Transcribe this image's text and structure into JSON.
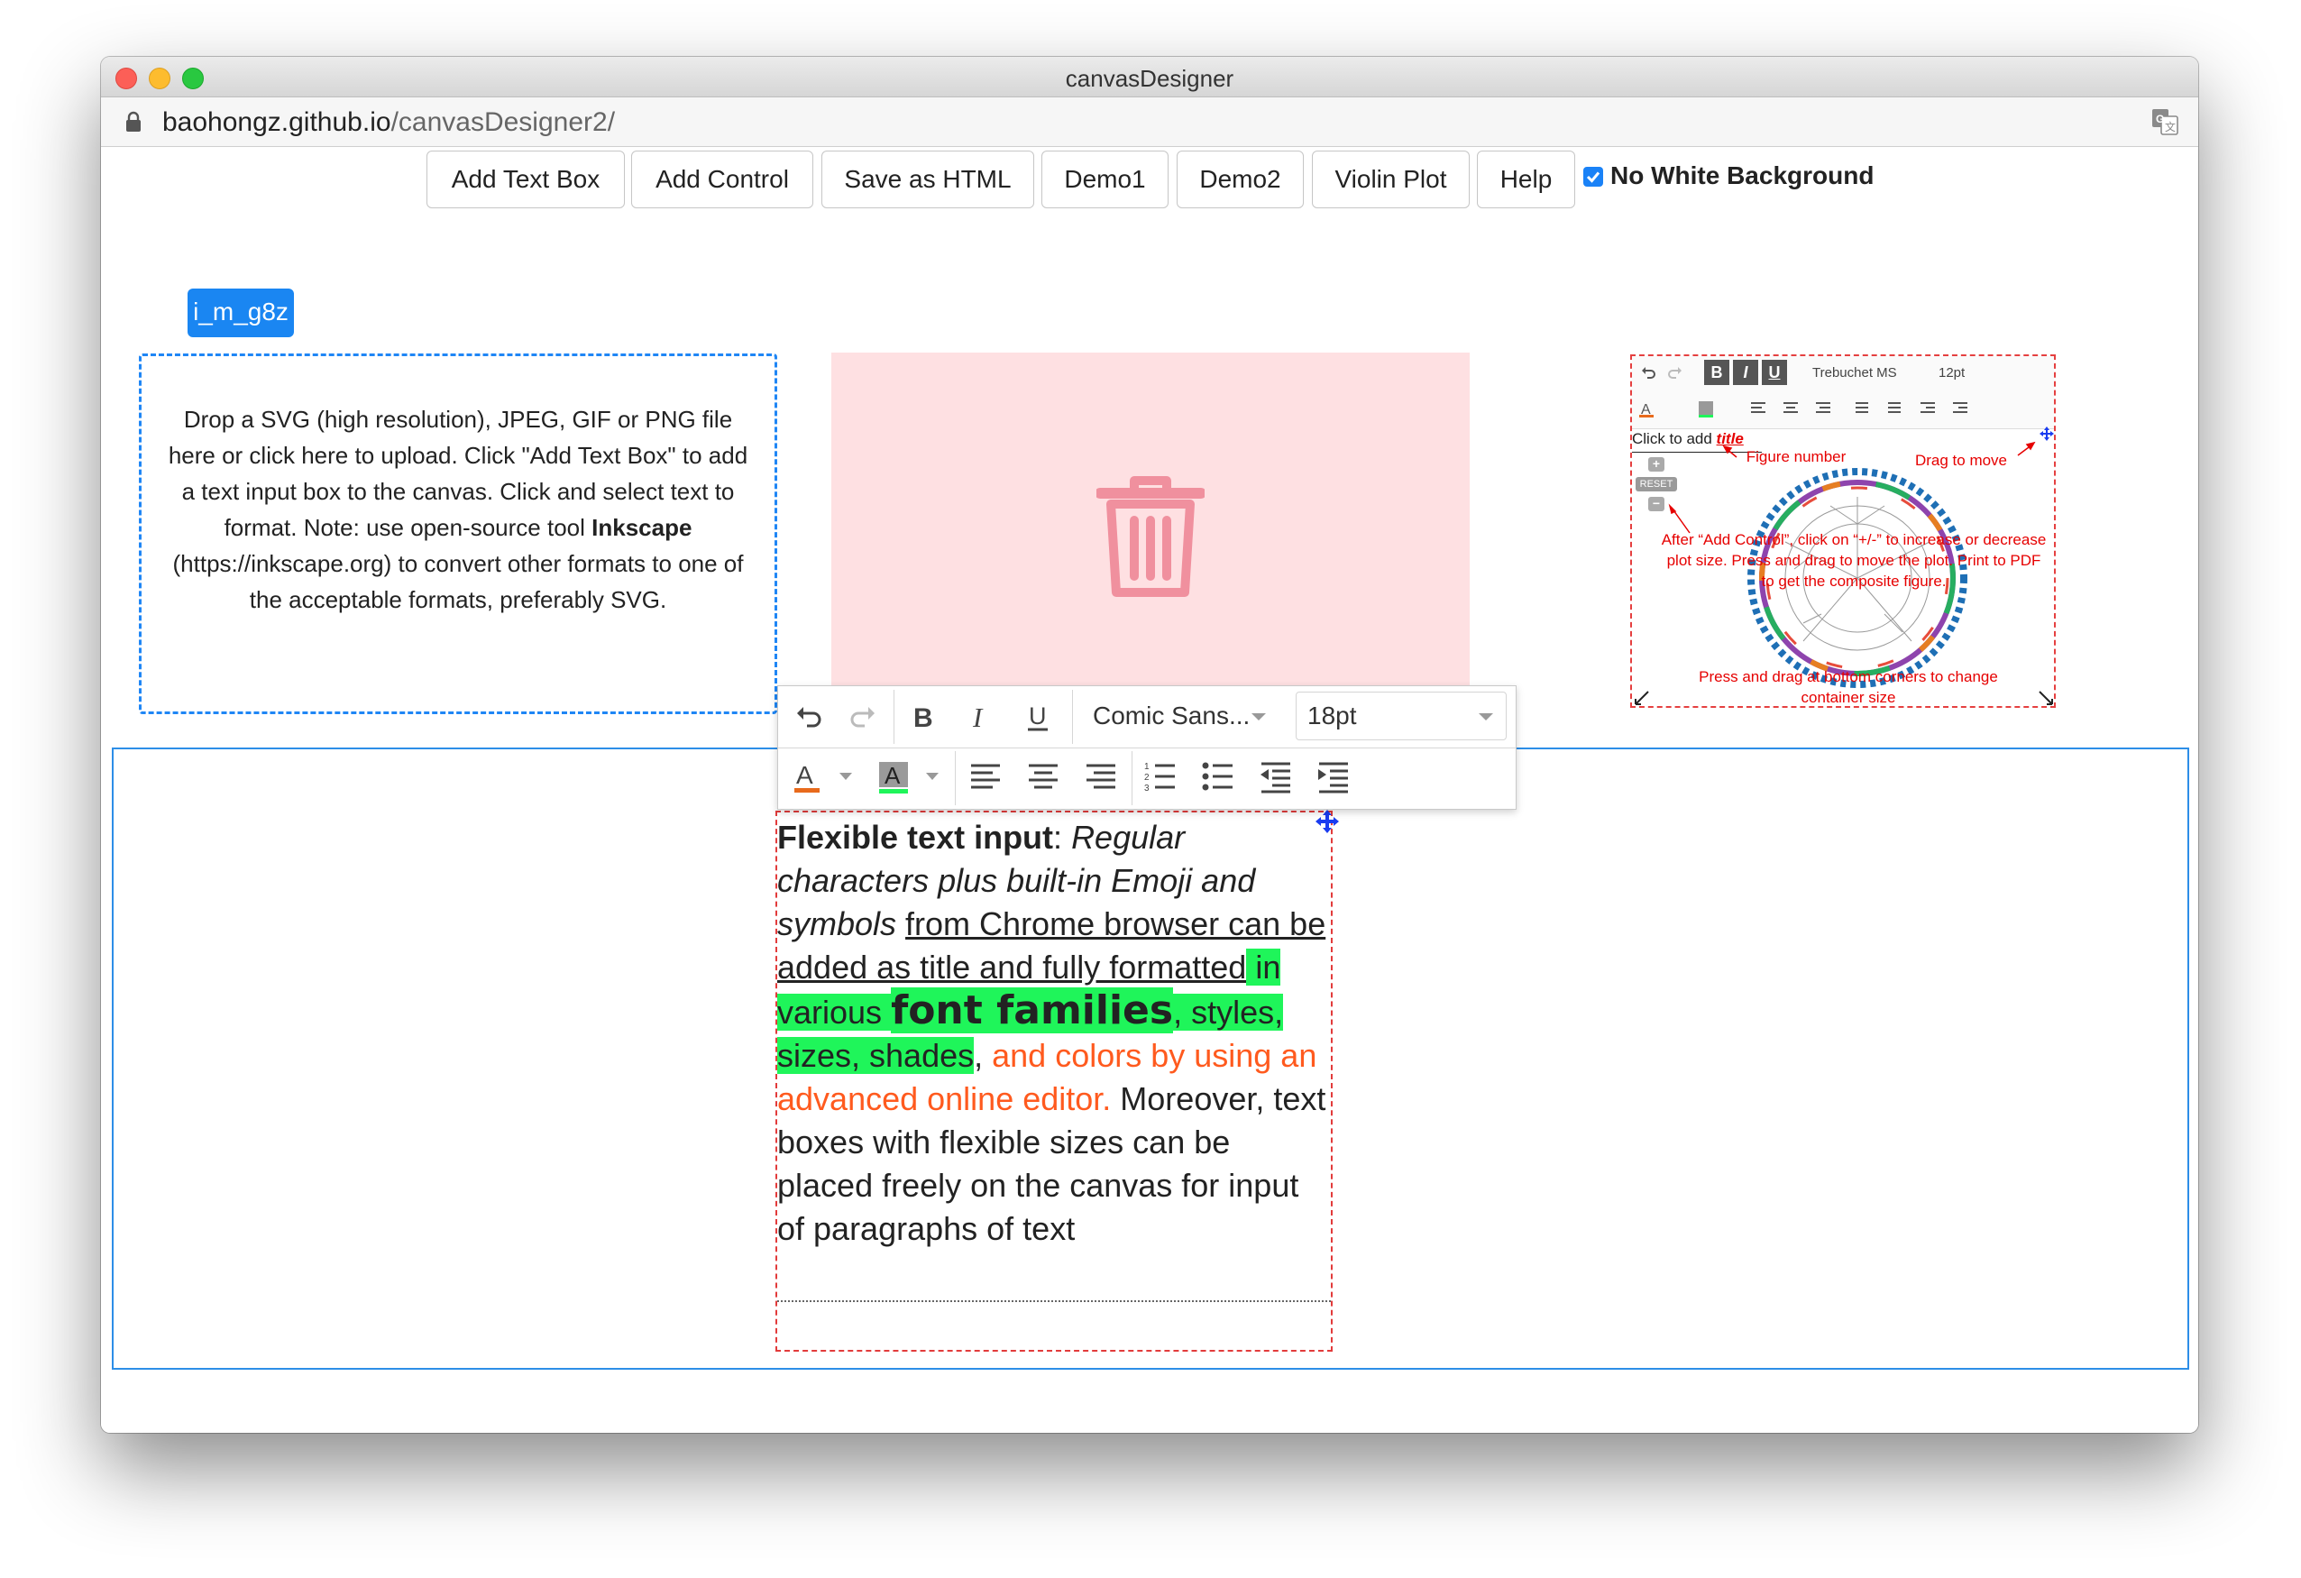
{
  "window": {
    "title": "canvasDesigner"
  },
  "address": {
    "host": "baohongz.github.io",
    "path": "/canvasDesigner2/"
  },
  "toolbar": {
    "buttons": [
      {
        "label": "Add Text Box"
      },
      {
        "label": "Add Control"
      },
      {
        "label": "Save as HTML"
      },
      {
        "label": "Demo1"
      },
      {
        "label": "Demo2"
      },
      {
        "label": "Violin Plot"
      },
      {
        "label": "Help"
      }
    ],
    "checkbox_label": "No White Background",
    "checkbox_checked": true
  },
  "element_tag": "i_m_g8z",
  "upload_box": {
    "text_part1": "Drop a SVG (high resolution), JPEG, GIF or PNG file here or click here to upload. Click \"Add Text Box\" to add a text input box to the canvas. Click and select text to format. Note: use open-source tool ",
    "text_bold": "Inkscape",
    "text_part2": " (https://inkscape.org) to convert other formats to one of the acceptable formats, preferably SVG."
  },
  "editor": {
    "font_family": "Comic Sans...",
    "font_size": "18pt"
  },
  "textbox": {
    "bold": "Flexible text input",
    "colon": ": ",
    "italic": "Regular characters plus built-in Emoji and symbols",
    "space1": " ",
    "underlined": "from Chrome browser can be added as title and fully formatted",
    "hl1": " in various ",
    "comic": "font families",
    "hl2": ", styles, sizes, shades",
    "comma": ", ",
    "orange": "and colors by using an advanced online editor.",
    "plain": " Moreover, text boxes with flexible sizes can be placed freely on the canvas for input of paragraphs of text"
  },
  "mini_preview": {
    "font": "Trebuchet MS",
    "size": "12pt",
    "title_prefix": "Click to add ",
    "title_word": "title",
    "reset_label": "RESET",
    "notes": {
      "figure_number": "Figure number",
      "drag_to_move": "Drag to move",
      "instructions": "After “Add Control”, click on “+/-” to increase or decrease plot size. Press and drag to move the plot. Print to PDF to get the composite figure.",
      "resize": "Press and drag at bottom corners to change container size"
    }
  },
  "colors": {
    "accent": "#1a86f2",
    "highlight": "#1ff55a",
    "orange_text": "#ff5a1e",
    "trash_zone": "#fee0e2",
    "trash_icon": "#f0909e",
    "annotation_red": "#e60000"
  }
}
